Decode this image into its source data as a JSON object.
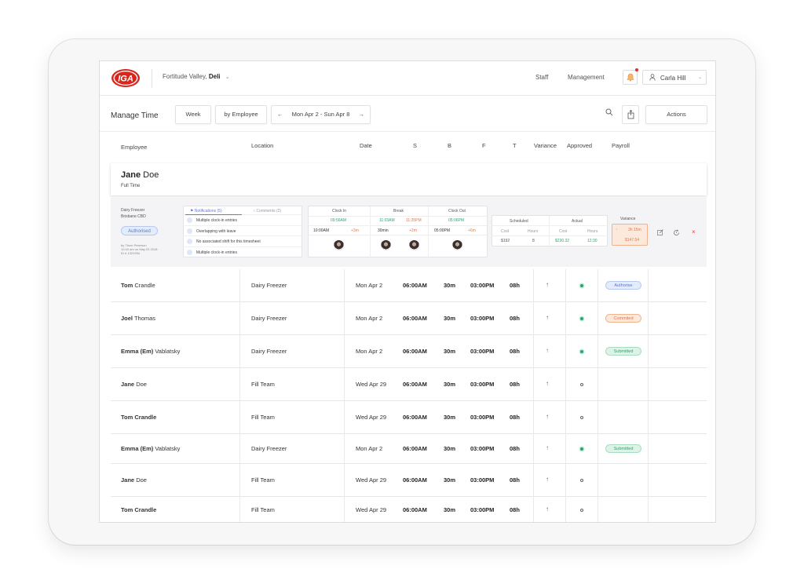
{
  "header": {
    "logo_text": "IGA",
    "store_location": "Fortitude Valley,",
    "store_dept": "Deli",
    "nav": [
      "Staff",
      "Management"
    ],
    "user_name": "Carla Hill"
  },
  "toolbar": {
    "title": "Manage Time",
    "view_week": "Week",
    "view_group": "by Employee",
    "date_range": "Mon Apr 2 - Sun Apr 8",
    "actions_label": "Actions"
  },
  "columns": [
    "Employee",
    "Location",
    "Date",
    "S",
    "B",
    "F",
    "T",
    "Variance",
    "Approved",
    "Payroll"
  ],
  "selected": {
    "first": "Jane",
    "last": "Doe",
    "type": "Full Time",
    "dept": "Dairy Freezer",
    "site": "Brisbane CBD",
    "status": "Authorised",
    "by_line1": "by Thom Peterson",
    "by_line2": "10:40 am on May 03 2018",
    "by_line3": "ID # 1321994",
    "tab_notifications": "Notifications (5)",
    "tab_comments": "Comments (2)",
    "notifications": [
      "Multiple clock-in entries",
      "Overlapping with leave",
      "No associated shift for this timesheet",
      "Multiple clock-in entries"
    ],
    "clock": {
      "in_label": "Clock In",
      "break_label": "Break",
      "out_label": "Clock Out",
      "in_sched": "09:56AM",
      "break_start": "11:03AM",
      "break_end": "11:35PM",
      "out_sched": "05:06PM",
      "in_actual": "10:00AM",
      "in_diff": "+3m",
      "break_dur": "30min",
      "break_diff": "+2m",
      "out_actual": "05:00PM",
      "out_diff": "+6m"
    },
    "sched": {
      "scheduled_label": "Scheduled",
      "actual_label": "Actual",
      "cost_label": "Cost",
      "hours_label": "Hours",
      "sched_cost": "$192",
      "sched_hours": "8",
      "actual_cost": "$230.32",
      "actual_hours": "12:30"
    },
    "variance": {
      "label": "Variance",
      "time": "3h 15m",
      "amount": "$147.54"
    }
  },
  "rows": [
    {
      "first": "Tom",
      "last": "Crandle",
      "location": "Dairy Freezer",
      "date": "Mon Apr 2",
      "start": "06:00AM",
      "brk": "30m",
      "finish": "03:00PM",
      "total": "08h",
      "variance_color": "#555",
      "approved": true,
      "payroll": "Authorise",
      "payroll_bg": "#e4ebfb",
      "payroll_border": "#b8c9f1",
      "payroll_color": "#5a78c9"
    },
    {
      "first": "Joel",
      "last": "Thomas",
      "location": "Dairy Freezer",
      "date": "Mon Apr 2",
      "start": "06:00AM",
      "brk": "30m",
      "finish": "03:00PM",
      "total": "08h",
      "variance_color": "#555",
      "approved": true,
      "payroll": "Commited",
      "payroll_bg": "#fde8dc",
      "payroll_border": "#f2b48e",
      "payroll_color": "#d9784a"
    },
    {
      "first": "Emma (Em)",
      "last": "Vablatsky",
      "location": "Dairy Freezer",
      "date": "Mon Apr 2",
      "start": "06:00AM",
      "brk": "30m",
      "finish": "03:00PM",
      "total": "08h",
      "variance_color": "#e0452b",
      "approved": true,
      "payroll": "Submitted",
      "payroll_bg": "#ddf3e8",
      "payroll_border": "#a8dcc0",
      "payroll_color": "#3d9c6a"
    },
    {
      "first": "Jane",
      "last": "Doe",
      "location": "Fill Team",
      "date": "Wed Apr 29",
      "start": "06:00AM",
      "brk": "30m",
      "finish": "03:00PM",
      "total": "08h",
      "variance_color": "#555",
      "approved": false,
      "payroll": ""
    },
    {
      "first": "Tom Crandle",
      "last": "",
      "location": "Fill Team",
      "date": "Wed Apr 29",
      "start": "06:00AM",
      "brk": "30m",
      "finish": "03:00PM",
      "total": "08h",
      "variance_color": "#555",
      "approved": false,
      "payroll": ""
    },
    {
      "first": "Emma (Em)",
      "last": "Vablatsky",
      "location": "Dairy Freezer",
      "date": "Mon Apr 2",
      "start": "06:00AM",
      "brk": "30m",
      "finish": "03:00PM",
      "total": "08h",
      "variance_color": "#e0452b",
      "approved": true,
      "payroll": "Submitted",
      "payroll_bg": "#ddf3e8",
      "payroll_border": "#a8dcc0",
      "payroll_color": "#3d9c6a"
    },
    {
      "first": "Jane",
      "last": "Doe",
      "location": "Fill Team",
      "date": "Wed Apr 29",
      "start": "06:00AM",
      "brk": "30m",
      "finish": "03:00PM",
      "total": "08h",
      "variance_color": "#555",
      "approved": false,
      "payroll": ""
    },
    {
      "first": "Tom Crandle",
      "last": "",
      "location": "Fill Team",
      "date": "Wed Apr 29",
      "start": "06:00AM",
      "brk": "30m",
      "finish": "03:00PM",
      "total": "08h",
      "variance_color": "#555",
      "approved": false,
      "payroll": ""
    }
  ],
  "colors": {
    "brand": "#d9261c",
    "accent_blue": "#5a7be0",
    "approved_green": "#2ba673",
    "variance_orange": "#e0784a"
  }
}
